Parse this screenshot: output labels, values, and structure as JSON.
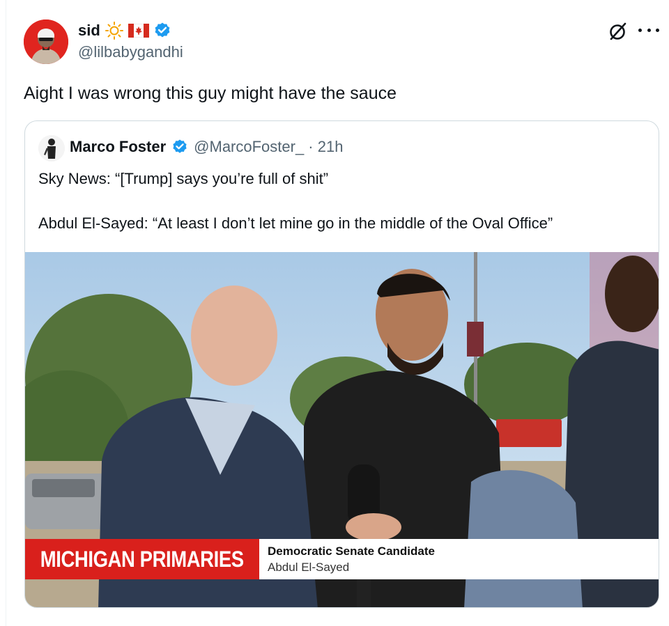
{
  "post": {
    "display_name": "sid",
    "handle": "@lilbabygandhi",
    "text": "Aight I was wrong this guy might have the sauce"
  },
  "quoted": {
    "display_name": "Marco Foster",
    "handle_time": "@MarcoFoster_ · 21h",
    "line1": "Sky News: “[Trump] says you’re full of shit”",
    "line2": "Abdul El-Sayed: “At least I don’t let mine go in the middle of the Oval Office”"
  },
  "video": {
    "banner": "MICHIGAN PRIMARIES",
    "caption_title": "Democratic Senate Candidate",
    "caption_name": "Abdul El-Sayed"
  },
  "colors": {
    "verified": "#1d9bf0",
    "banner_red": "#d9201c",
    "avatar_red": "#e0251f"
  },
  "icons": [
    "sun-icon",
    "canada-flag-icon",
    "verified-badge-icon",
    "grok-icon",
    "more-icon"
  ]
}
